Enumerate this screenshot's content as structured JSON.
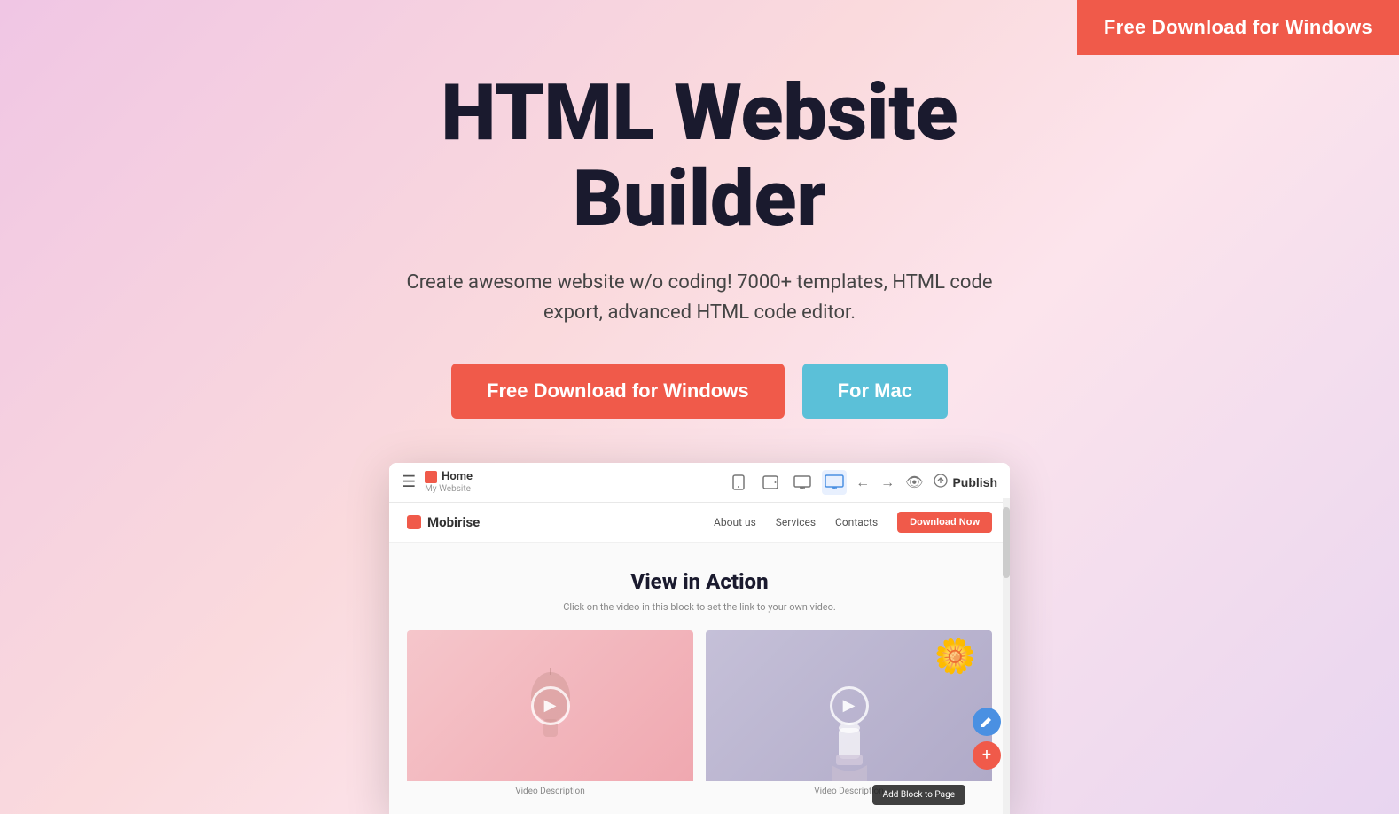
{
  "topCta": {
    "label": "Free Download for Windows"
  },
  "hero": {
    "title": "HTML Website Builder",
    "subtitle": "Create awesome website w/o coding! 7000+ templates, HTML code export, advanced HTML code editor.",
    "btnWindows": "Free Download for Windows",
    "btnMac": "For Mac"
  },
  "mockup": {
    "toolbar": {
      "hamburgerLabel": "☰",
      "homeLabel": "Home",
      "homeSubLabel": "My Website",
      "viewMobile": "mobile-icon",
      "viewTablet": "tablet-icon",
      "viewDesktopSmall": "desktop-small-icon",
      "viewDesktopLarge": "desktop-large-icon",
      "undoLabel": "←",
      "redoLabel": "→",
      "previewLabel": "👁",
      "publishIconLabel": "⬆",
      "publishLabel": "Publish"
    },
    "innerNav": {
      "brandName": "Mobirise",
      "links": [
        "About us",
        "Services",
        "Contacts"
      ],
      "downloadBtn": "Download Now"
    },
    "content": {
      "title": "View in Action",
      "subtitle": "Click on the video in this block to set the link to your own video.",
      "videos": [
        {
          "desc": "Video Description",
          "bg": "pink"
        },
        {
          "desc": "Video Description",
          "bg": "purple"
        }
      ]
    },
    "addBlockLabel": "Add Block to Page"
  }
}
